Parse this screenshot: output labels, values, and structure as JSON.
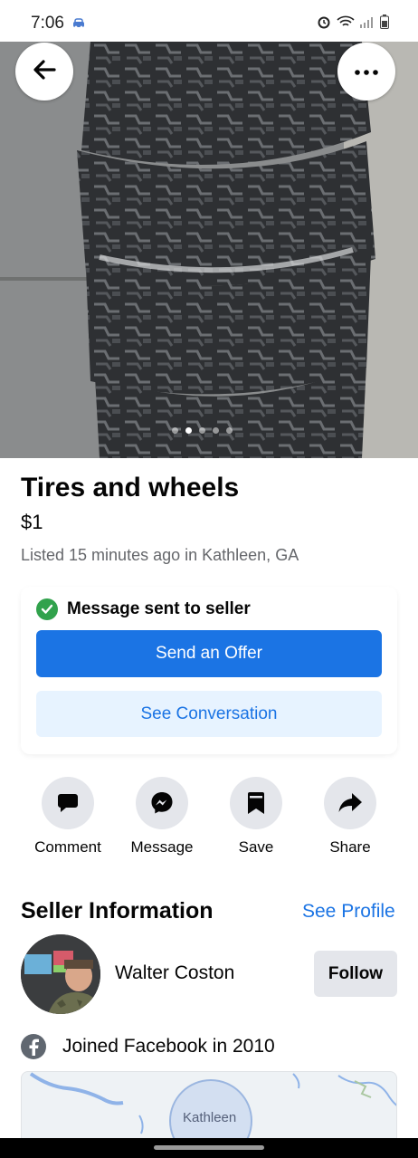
{
  "status_bar": {
    "time": "7:06",
    "icons": [
      "car-icon",
      "alarm-icon",
      "wifi-icon",
      "signal-icon",
      "battery-icon"
    ]
  },
  "photo": {
    "description_icon": "listing-photo",
    "image_count": 5,
    "active_index": 1
  },
  "top_controls": {
    "back_icon": "arrow-left-icon",
    "more_icon": "more-horizontal-icon"
  },
  "listing": {
    "title": "Tires and wheels",
    "price": "$1",
    "meta": "Listed 15 minutes ago in Kathleen, GA"
  },
  "message_card": {
    "status": "Message sent to seller",
    "offer_button": "Send an Offer",
    "conversation_button": "See Conversation"
  },
  "actions": [
    {
      "label": "Comment",
      "icon": "comment-icon"
    },
    {
      "label": "Message",
      "icon": "messenger-icon"
    },
    {
      "label": "Save",
      "icon": "bookmark-icon"
    },
    {
      "label": "Share",
      "icon": "share-icon"
    }
  ],
  "seller": {
    "heading": "Seller Information",
    "see_profile": "See Profile",
    "name": "Walter Coston",
    "follow": "Follow",
    "joined": "Joined Facebook in 2010"
  },
  "map": {
    "label": "Kathleen"
  },
  "colors": {
    "accent": "#1b74e4",
    "accent_light": "#e7f3ff",
    "success": "#31a24c",
    "secondary_text": "#65676b",
    "button_gray": "#e4e6eb"
  }
}
